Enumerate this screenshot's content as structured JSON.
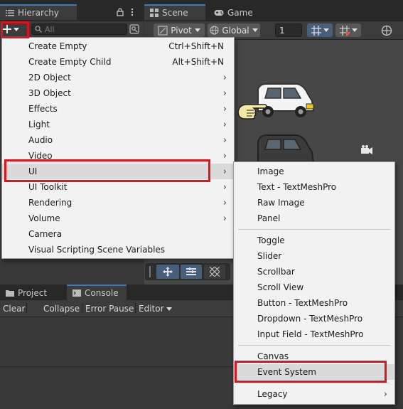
{
  "hierarchy": {
    "title": "Hierarchy",
    "search_placeholder": "All"
  },
  "scene_tabs": [
    {
      "label": "Scene"
    },
    {
      "label": "Game"
    }
  ],
  "scene_toolbar": {
    "pivot": "Pivot",
    "global": "Global",
    "snap_value": "1"
  },
  "create_menu": {
    "items": [
      {
        "label": "Create Empty",
        "shortcut": "Ctrl+Shift+N"
      },
      {
        "label": "Create Empty Child",
        "shortcut": "Alt+Shift+N"
      },
      {
        "label": "2D Object",
        "arrow": "›"
      },
      {
        "label": "3D Object",
        "arrow": "›"
      },
      {
        "label": "Effects",
        "arrow": "›"
      },
      {
        "label": "Light",
        "arrow": "›"
      },
      {
        "label": "Audio",
        "arrow": "›"
      },
      {
        "label": "Video",
        "arrow": "›"
      },
      {
        "label": "UI",
        "arrow": "›"
      },
      {
        "label": "UI Toolkit",
        "arrow": "›"
      },
      {
        "label": "Rendering",
        "arrow": "›"
      },
      {
        "label": "Volume",
        "arrow": "›"
      },
      {
        "label": "Camera"
      },
      {
        "label": "Visual Scripting Scene Variables"
      }
    ]
  },
  "ui_submenu": {
    "items": [
      {
        "label": "Image"
      },
      {
        "label": "Text - TextMeshPro"
      },
      {
        "label": "Raw Image"
      },
      {
        "label": "Panel"
      },
      {
        "label": "Toggle"
      },
      {
        "label": "Slider"
      },
      {
        "label": "Scrollbar"
      },
      {
        "label": "Scroll View"
      },
      {
        "label": "Button - TextMeshPro"
      },
      {
        "label": "Dropdown - TextMeshPro"
      },
      {
        "label": "Input Field - TextMeshPro"
      },
      {
        "label": "Canvas"
      },
      {
        "label": "Event System"
      },
      {
        "label": "Legacy",
        "arrow": "›"
      }
    ]
  },
  "bottom_tabs": [
    {
      "label": "Project"
    },
    {
      "label": "Console"
    }
  ],
  "console_toolbar": {
    "clear": "Clear",
    "collapse": "Collapse",
    "error_pause": "Error Pause",
    "editor": "Editor"
  },
  "colors": {
    "highlight_box": "#e0131b",
    "menu_bg": "#f2f2f2",
    "editor_bg": "#383838",
    "accent": "#3a79bb"
  }
}
